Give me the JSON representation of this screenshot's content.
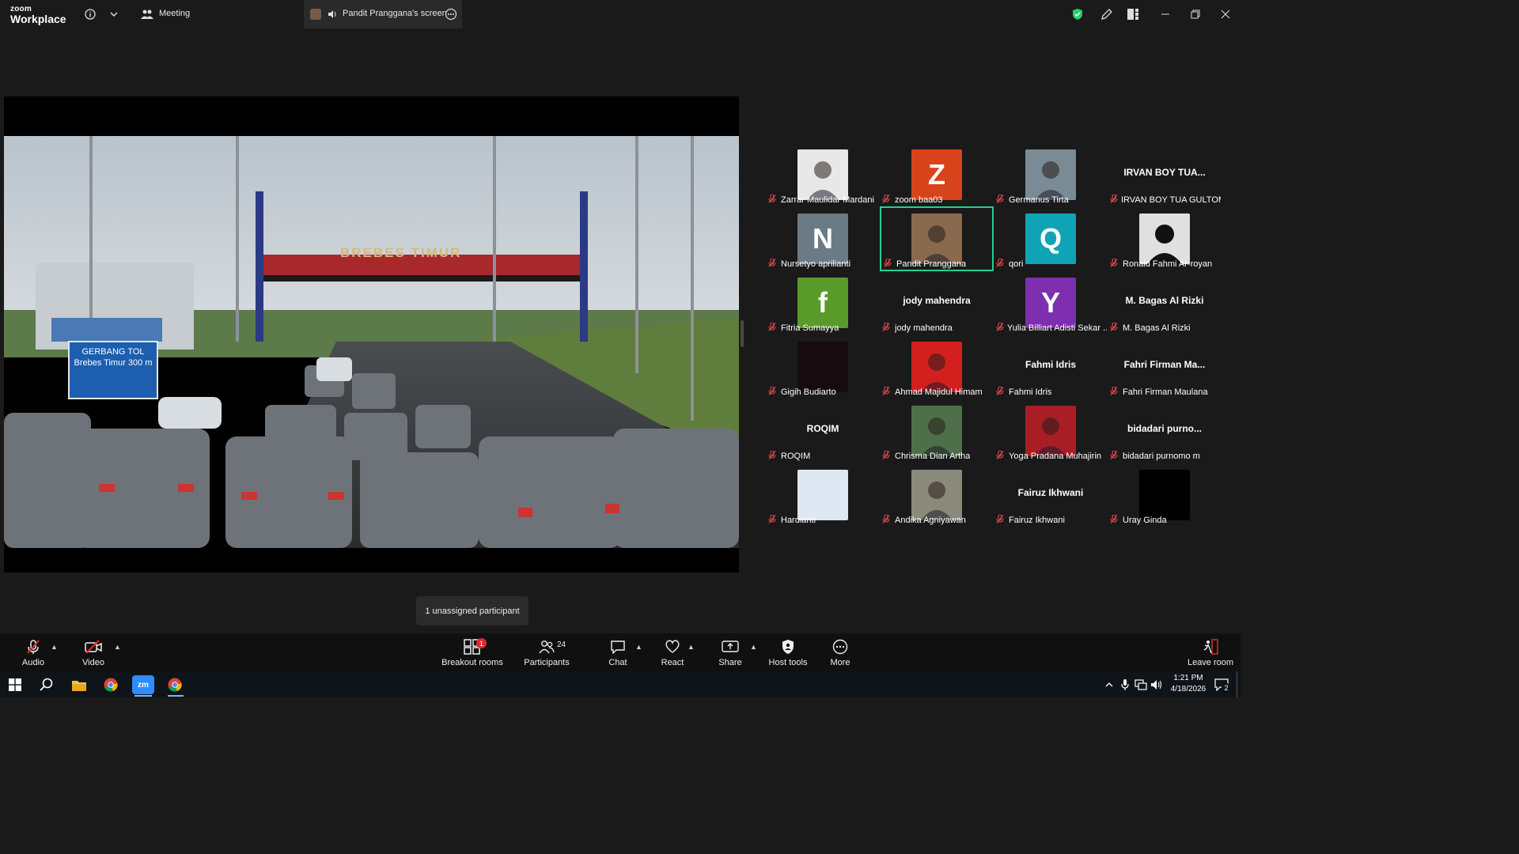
{
  "titlebar": {
    "logo_top": "zoom",
    "logo_bottom": "Workplace",
    "meeting_label": "Meeting",
    "screen_tab_label": "Pandit Pranggana's screen"
  },
  "colors": {
    "accent_green": "#23d18b",
    "mute_red": "#e5484d",
    "shield_green": "#2ecc71",
    "leave_red": "#e02828"
  },
  "share": {
    "sign_text": "BREBES TIMUR",
    "gate_sign": "GERBANG TOL Brebes Timur 300 m"
  },
  "participants": [
    {
      "name": "Zarrar Maulidar Mardani",
      "avatar": "photo",
      "color": "#e8e8e8"
    },
    {
      "name": "zoom baa03",
      "avatar": "letter",
      "letter": "Z",
      "color": "#d9431b"
    },
    {
      "name": "Germanus Tirta",
      "avatar": "photo",
      "color": "#7b8b96"
    },
    {
      "name": "IRVAN BOY TUA GULTOM",
      "avatar": "text",
      "display": "IRVAN BOY TUA..."
    },
    {
      "name": "Nursetyo aprilianti",
      "avatar": "letter",
      "letter": "N",
      "color": "#6b7b86"
    },
    {
      "name": "Pandit Pranggana",
      "avatar": "photo",
      "color": "#8a6a4f",
      "active": true
    },
    {
      "name": "qori",
      "avatar": "letter",
      "letter": "Q",
      "color": "#0fa4b5"
    },
    {
      "name": "Ronald Fahmi Ar-royan",
      "avatar": "silhouette",
      "color": "#e0e0e0"
    },
    {
      "name": "Fitria Sumayya",
      "avatar": "letter",
      "letter": "f",
      "color": "#5a9a2a"
    },
    {
      "name": "jody mahendra",
      "avatar": "text",
      "display": "jody mahendra"
    },
    {
      "name": "Yulia Billiart Adisti Sekar ...",
      "avatar": "letter",
      "letter": "Y",
      "color": "#7d2fb0"
    },
    {
      "name": "M. Bagas Al Rizki",
      "avatar": "text",
      "display": "M. Bagas Al Rizki"
    },
    {
      "name": "Gigih Budiarto",
      "avatar": "photo",
      "color": "#160c10"
    },
    {
      "name": "Ahmad Majidul Himam",
      "avatar": "photo",
      "color": "#d41f1f"
    },
    {
      "name": "Fahmi Idris",
      "avatar": "text",
      "display": "Fahmi Idris"
    },
    {
      "name": "Fahri Firman Maulana",
      "avatar": "text",
      "display": "Fahri Firman Ma..."
    },
    {
      "name": "ROQIM",
      "avatar": "text",
      "display": "ROQIM"
    },
    {
      "name": "Chrisma Dian Artha",
      "avatar": "photo",
      "color": "#4f6f4a"
    },
    {
      "name": "Yoga Pradana Muhajirin",
      "avatar": "photo",
      "color": "#a81e24"
    },
    {
      "name": "bidadari purnomo m",
      "avatar": "text",
      "display": "bidadari  purno..."
    },
    {
      "name": "Hardianti",
      "avatar": "photo",
      "color": "#dde8f2"
    },
    {
      "name": "Andika Agniyawan",
      "avatar": "photo",
      "color": "#8a8a7a"
    },
    {
      "name": "Fairuz Ikhwani",
      "avatar": "text",
      "display": "Fairuz Ikhwani"
    },
    {
      "name": "Uray Ginda",
      "avatar": "photo",
      "color": "#000000"
    }
  ],
  "tooltip": "1 unassigned participant",
  "toolbar": {
    "audio": "Audio",
    "video": "Video",
    "breakout": "Breakout rooms",
    "breakout_badge": "1",
    "participants": "Participants",
    "participants_count": "24",
    "chat": "Chat",
    "react": "React",
    "share": "Share",
    "host_tools": "Host tools",
    "more": "More",
    "leave": "Leave room"
  },
  "taskbar": {
    "time": "1:21 PM",
    "date": "4/18/2026",
    "notification_count": "2"
  }
}
